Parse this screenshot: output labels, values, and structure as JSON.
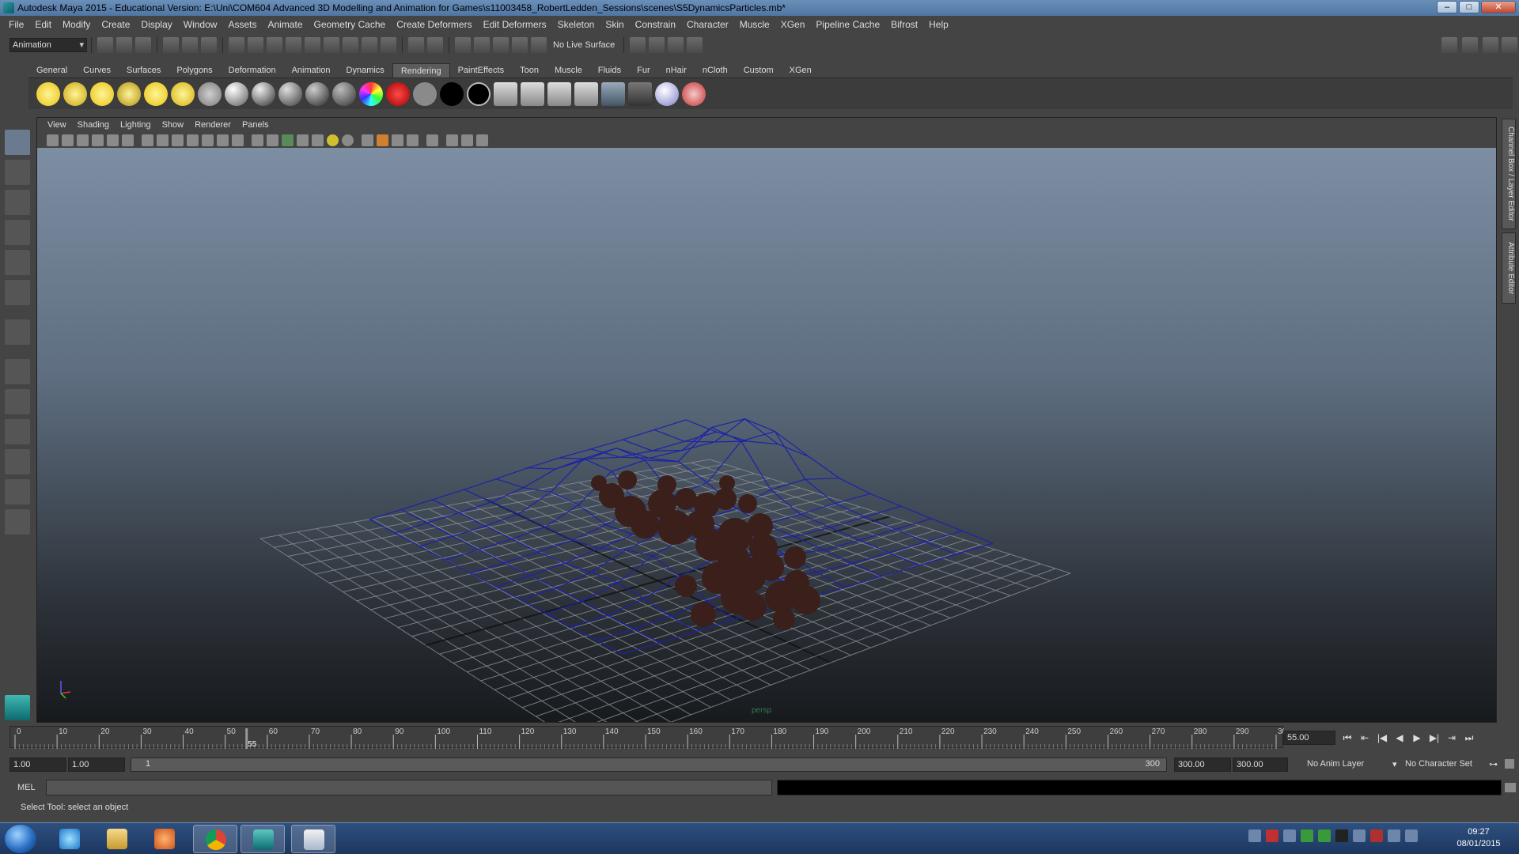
{
  "window": {
    "title": "Autodesk Maya 2015 - Educational Version: E:\\Uni\\COM604 Advanced 3D Modelling and Animation for Games\\s11003458_RobertLedden_Sessions\\scenes\\S5DynamicsParticles.mb*",
    "minimize": "–",
    "maximize": "□",
    "close": "✕"
  },
  "menubar": [
    "File",
    "Edit",
    "Modify",
    "Create",
    "Display",
    "Window",
    "Assets",
    "Animate",
    "Geometry Cache",
    "Create Deformers",
    "Edit Deformers",
    "Skeleton",
    "Skin",
    "Constrain",
    "Character",
    "Muscle",
    "XGen",
    "Pipeline Cache",
    "Bifrost",
    "Help"
  ],
  "statusline": {
    "mode": "Animation",
    "live_surface": "No Live Surface"
  },
  "shelf": {
    "tabs": [
      "General",
      "Curves",
      "Surfaces",
      "Polygons",
      "Deformation",
      "Animation",
      "Dynamics",
      "Rendering",
      "PaintEffects",
      "Toon",
      "Muscle",
      "Fluids",
      "Fur",
      "nHair",
      "nCloth",
      "Custom",
      "XGen"
    ],
    "active_tab": "Rendering"
  },
  "panel": {
    "menu": [
      "View",
      "Shading",
      "Lighting",
      "Show",
      "Renderer",
      "Panels"
    ],
    "camera_label": "persp"
  },
  "right_tabs": [
    "Channel Box / Layer Editor",
    "Attribute Editor"
  ],
  "timeline": {
    "ticks": [
      "0",
      "10",
      "20",
      "30",
      "40",
      "50",
      "60",
      "70",
      "80",
      "90",
      "100",
      "110",
      "120",
      "130",
      "140",
      "150",
      "160",
      "170",
      "180",
      "190",
      "200",
      "210",
      "220",
      "230",
      "240",
      "250",
      "260",
      "270",
      "280",
      "290",
      "30"
    ],
    "current_frame_label": "55",
    "current_time": "55.00",
    "playback": [
      "⏮",
      "⇤",
      "|◀",
      "◀",
      "▶",
      "▶|",
      "⇥",
      "⏭"
    ]
  },
  "range": {
    "start_time": "1.00",
    "playback_start": "1.00",
    "slider_start": "1",
    "slider_end": "300",
    "playback_end": "300.00",
    "end_time": "300.00",
    "anim_layer": "No Anim Layer",
    "character_set": "No Character Set"
  },
  "commandline": {
    "label": "MEL"
  },
  "helpline": "Select Tool: select an object",
  "taskbar": {
    "time": "09:27",
    "date": "08/01/2015"
  }
}
